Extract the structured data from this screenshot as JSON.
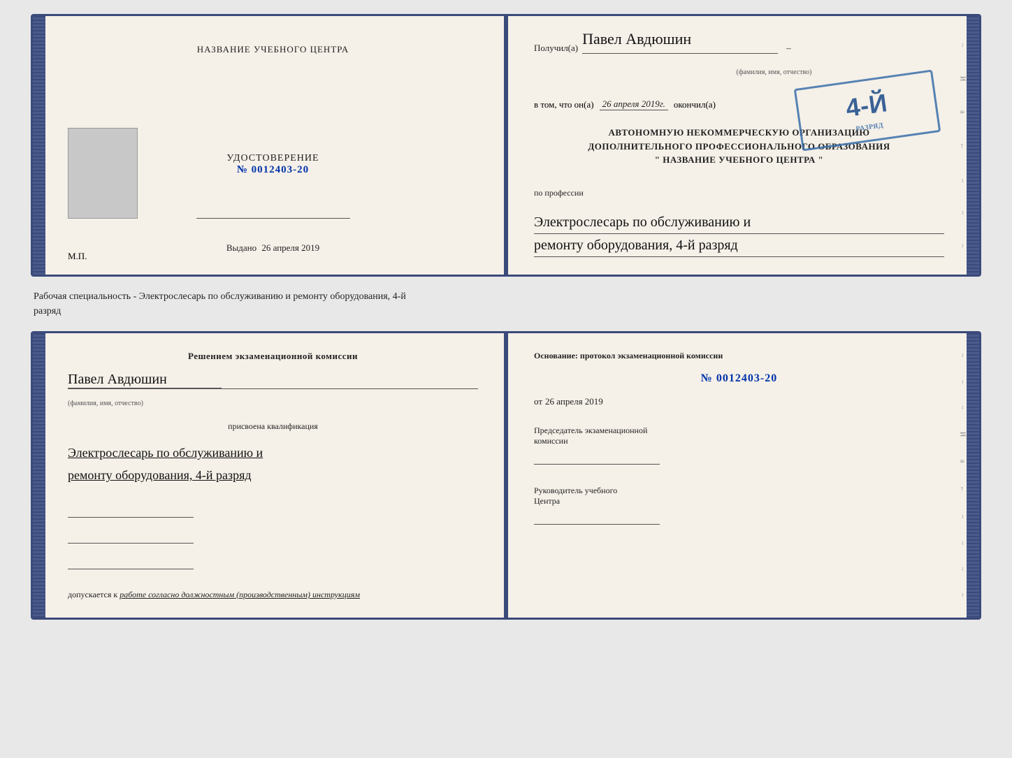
{
  "top_book": {
    "left_page": {
      "center_title": "НАЗВАНИЕ УЧЕБНОГО ЦЕНТРА",
      "cert_label": "УДОСТОВЕРЕНИЕ",
      "cert_number": "№ 0012403-20",
      "vydano_label": "Выдано",
      "vydano_date": "26 апреля 2019",
      "mp_label": "М.П."
    },
    "right_page": {
      "poluchil_label": "Получил(а)",
      "poluchil_name": "Павел Авдюшин",
      "fio_subtext": "(фамилия, имя, отчество)",
      "vtom_label": "в том, что он(а)",
      "vtom_date": "26 апреля 2019г.",
      "okonchil_label": "окончил(а)",
      "org_line1": "АВТОНОМНУЮ НЕКОММЕРЧЕСКУЮ ОРГАНИЗАЦИЮ",
      "org_line2": "ДОПОЛНИТЕЛЬНОГО ПРОФЕССИОНАЛЬНОГО ОБРАЗОВАНИЯ",
      "org_line3": "\" НАЗВАНИЕ УЧЕБНОГО ЦЕНТРА \"",
      "po_professii_label": "по профессии",
      "profession_line1": "Электрослесарь по обслуживанию и",
      "profession_line2": "ремонту оборудования, 4-й разряд",
      "stamp_big": "4-й",
      "stamp_sub": "разряд"
    }
  },
  "separator": {
    "text_line1": "Рабочая специальность - Электрослесарь по обслуживанию и ремонту оборудования, 4-й",
    "text_line2": "разряд"
  },
  "bottom_book": {
    "left_page": {
      "decision_text": "Решением экзаменационной комиссии",
      "name": "Павел Авдюшин",
      "fio_subtext": "(фамилия, имя, отчество)",
      "prisvoena_label": "присвоена квалификация",
      "qualification_line1": "Электрослесарь по обслуживанию и",
      "qualification_line2": "ремонту оборудования, 4-й разряд",
      "dopusk_label": "допускается к",
      "dopusk_value": "работе согласно должностным (производственным) инструкциям"
    },
    "right_page": {
      "osnov_label": "Основание: протокол экзаменационной комиссии",
      "protocol_number": "№ 0012403-20",
      "ot_label": "от",
      "ot_date": "26 апреля 2019",
      "chairman_line1": "Председатель экзаменационной",
      "chairman_line2": "комиссии",
      "rukov_line1": "Руководитель учебного",
      "rukov_line2": "Центра"
    }
  }
}
